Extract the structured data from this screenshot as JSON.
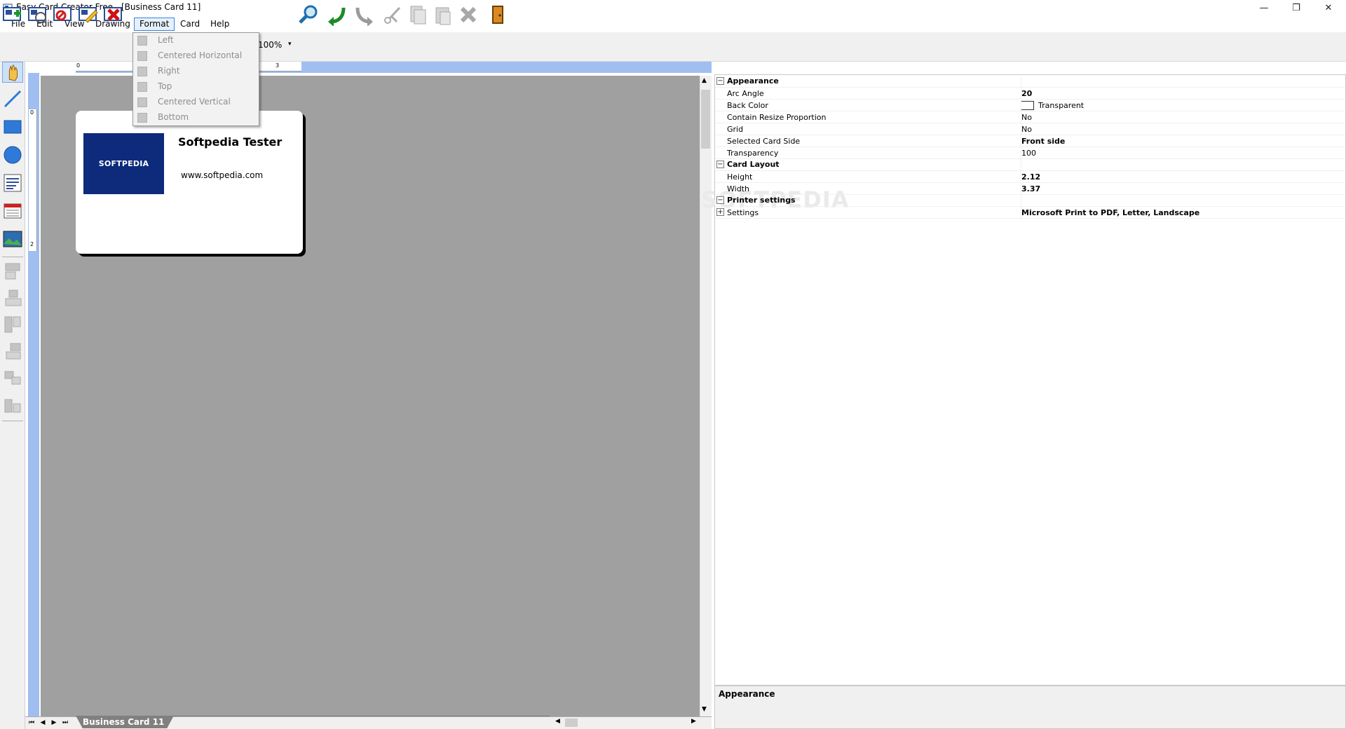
{
  "window": {
    "title": "Easy Card Creator Free - [Business Card 11]",
    "controls": [
      "minimize-icon",
      "restore-icon",
      "close-icon"
    ]
  },
  "menubar": {
    "items": [
      {
        "label": "File"
      },
      {
        "label": "Edit"
      },
      {
        "label": "View"
      },
      {
        "label": "Drawing"
      },
      {
        "label": "Format",
        "open": true
      },
      {
        "label": "Card"
      },
      {
        "label": "Help"
      }
    ]
  },
  "toolbar": {
    "zoom": "100%",
    "icons": [
      "new-card-icon",
      "open-card-icon",
      "save-card-icon",
      "edit-card-icon",
      "delete-card-icon",
      "zoom-icon",
      "undo-icon",
      "redo-icon",
      "cut-icon",
      "copy-icon",
      "paste-icon",
      "delete-icon",
      "exit-icon"
    ]
  },
  "left_tools": [
    "hand-tool-icon",
    "line-tool-icon",
    "rectangle-tool-icon",
    "ellipse-tool-icon",
    "text-tool-icon",
    "calendar-tool-icon",
    "image-tool-icon",
    "align-left-icon",
    "align-center-icon",
    "align-top-icon",
    "align-right-icon",
    "align-middle-icon",
    "align-bottom-icon"
  ],
  "format_menu": {
    "items": [
      {
        "label": "Left",
        "icon": "align-left-icon"
      },
      {
        "label": "Centered Horizontal",
        "icon": "align-center-horizontal-icon"
      },
      {
        "label": "Right",
        "icon": "align-right-icon"
      },
      {
        "label": "Top",
        "icon": "align-top-icon"
      },
      {
        "label": "Centered Vertical",
        "icon": "align-center-vertical-icon"
      },
      {
        "label": "Bottom",
        "icon": "align-bottom-icon"
      }
    ]
  },
  "rulers": {
    "h_labels": [
      "0",
      "3"
    ],
    "v_labels": [
      "0",
      "2"
    ]
  },
  "card": {
    "logo_text": "SOFTPEDIA",
    "name": "Softpedia Tester",
    "url": "www.softpedia.com",
    "logo_color": "#0d2a7b"
  },
  "tabs": {
    "active": "Business Card 11"
  },
  "properties": {
    "categories": [
      {
        "name": "Appearance",
        "rows": [
          {
            "name": "Arc Angle",
            "value": "20",
            "bold": true
          },
          {
            "name": "Back Color",
            "value": "Transparent",
            "swatch": true
          },
          {
            "name": "Contain Resize Proportion",
            "value": "No"
          },
          {
            "name": "Grid",
            "value": "No"
          },
          {
            "name": "Selected Card Side",
            "value": "Front side",
            "bold": true
          },
          {
            "name": "Transparency",
            "value": "100"
          }
        ]
      },
      {
        "name": "Card Layout",
        "rows": [
          {
            "name": "Height",
            "value": "2.12",
            "bold": true
          },
          {
            "name": "Width",
            "value": "3.37",
            "bold": true
          }
        ]
      },
      {
        "name": "Printer settings",
        "rows": [
          {
            "name": "Settings",
            "value": "Microsoft Print to PDF, Letter, Landscape",
            "bold": true,
            "expandable": true
          }
        ]
      }
    ],
    "description_title": "Appearance"
  }
}
